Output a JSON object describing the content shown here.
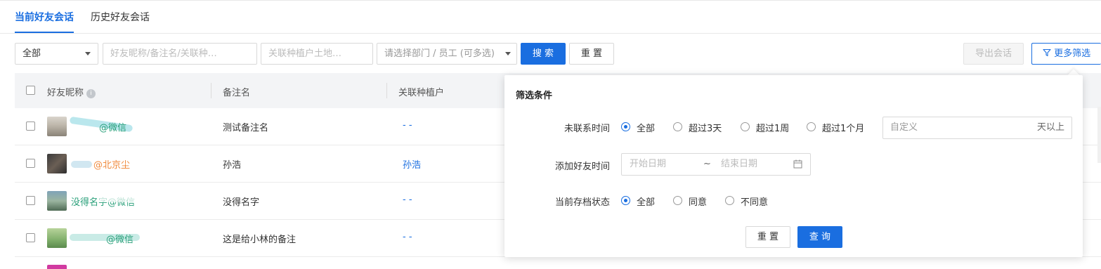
{
  "tabs": [
    {
      "label": "当前好友会话",
      "active": true
    },
    {
      "label": "历史好友会话",
      "active": false
    }
  ],
  "toolbar": {
    "scope_select": "全部",
    "nickname_placeholder": "好友昵称/备注名/关联种…",
    "land_placeholder": "关联种植户土地…",
    "dept_placeholder": "请选择部门 / 员工 (可多选)",
    "search_label": "搜 索",
    "reset_label": "重 置",
    "export_label": "导出会话",
    "more_filter_label": "更多筛选"
  },
  "table": {
    "columns": [
      "好友昵称",
      "备注名",
      "关联种植户"
    ],
    "rows": [
      {
        "nickname": "@微信",
        "note": "测试备注名",
        "related": "- -",
        "nick_color": "#2aa07a"
      },
      {
        "nickname": "@北京尘",
        "note": "孙浩",
        "related": "孙浩",
        "nick_color": "#f08a3c"
      },
      {
        "nickname": "没得名字@微信",
        "note": "没得名字",
        "related": "- -",
        "nick_color": "#2aa07a"
      },
      {
        "nickname": "@微信",
        "note": "这是给小林的备注",
        "related": "- -",
        "nick_color": "#2aa07a"
      }
    ]
  },
  "filter_panel": {
    "title": "筛选条件",
    "no_contact": {
      "label": "未联系时间",
      "options": [
        "全部",
        "超过3天",
        "超过1周",
        "超过1个月"
      ],
      "selected": "全部",
      "custom_placeholder": "自定义",
      "custom_suffix": "天以上"
    },
    "add_time": {
      "label": "添加好友时间",
      "start_placeholder": "开始日期",
      "separator": "~",
      "end_placeholder": "结束日期"
    },
    "archive_status": {
      "label": "当前存档状态",
      "options": [
        "全部",
        "同意",
        "不同意"
      ],
      "selected": "全部"
    },
    "reset_label": "重 置",
    "query_label": "查 询"
  },
  "colors": {
    "primary": "#1a6ee0"
  }
}
